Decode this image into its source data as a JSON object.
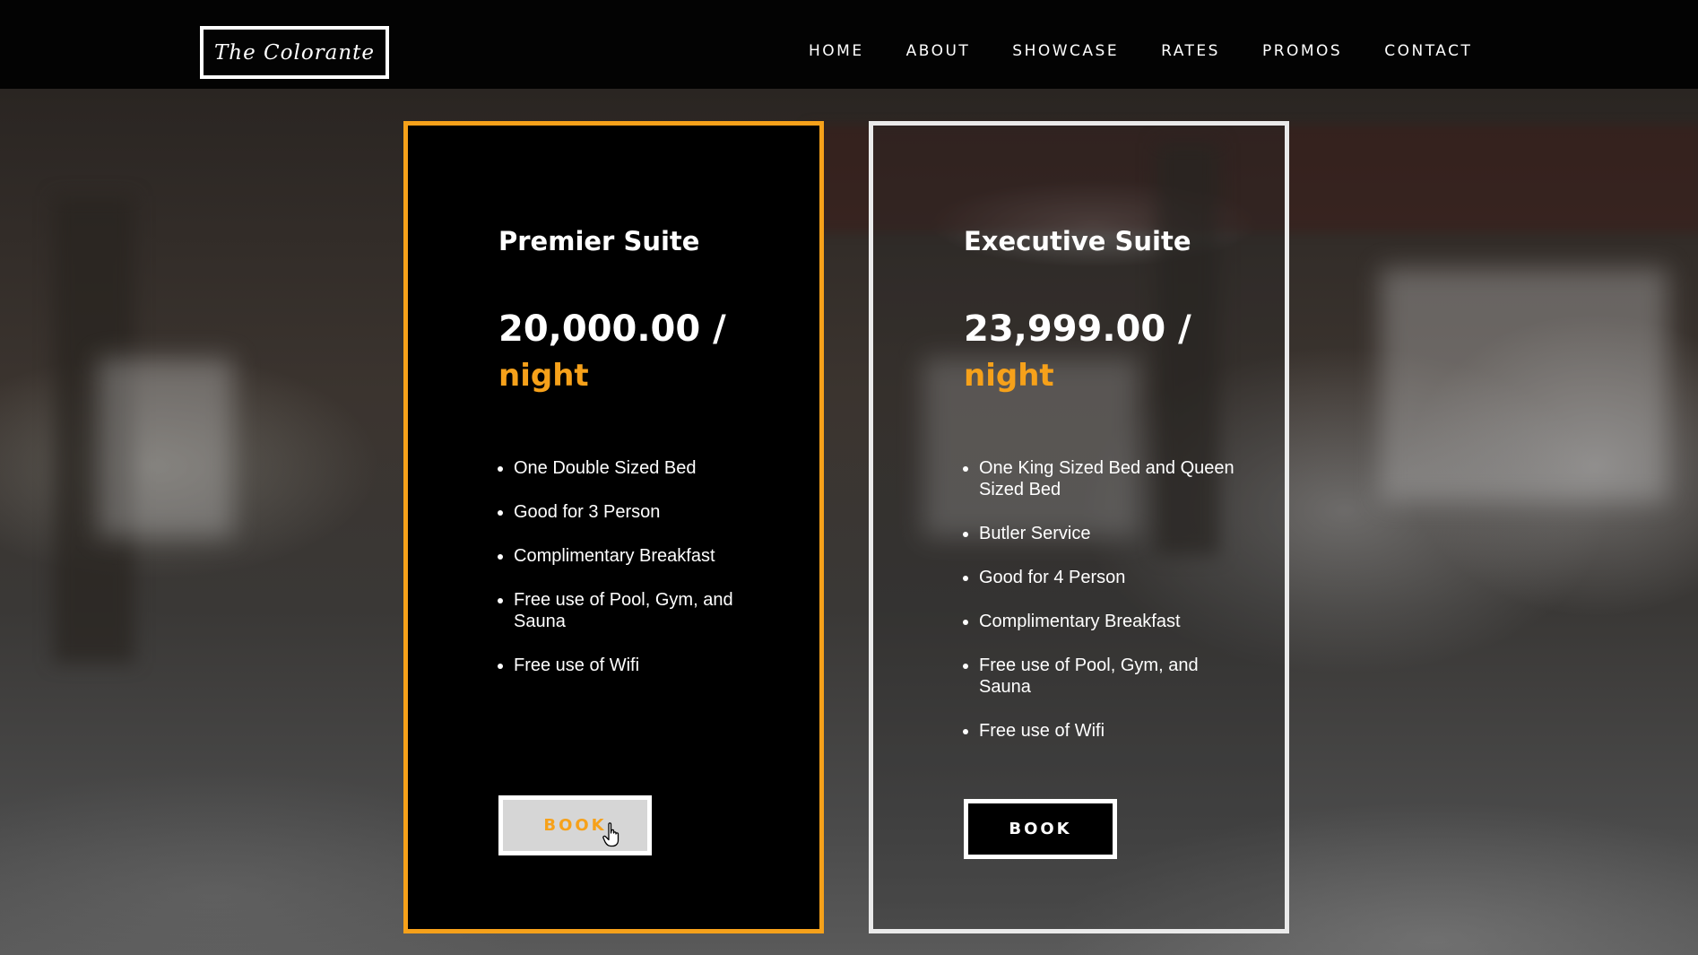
{
  "header": {
    "logo_text": "The Colorante",
    "nav": [
      "HOME",
      "ABOUT",
      "SHOWCASE",
      "RATES",
      "PROMOS",
      "CONTACT"
    ]
  },
  "cards": [
    {
      "title": "Premier Suite",
      "price": "20,000.00 /",
      "unit": "night",
      "features": [
        "One Double Sized Bed",
        "Good for 3 Person",
        "Complimentary Breakfast",
        "Free use of Pool, Gym, and Sauna",
        "Free use of Wifi"
      ],
      "button": "BOOK",
      "state": "hover"
    },
    {
      "title": "Executive Suite",
      "price": "23,999.00 /",
      "unit": "night",
      "features": [
        "One King Sized Bed and Queen Sized Bed",
        "Butler Service",
        "Good for 4 Person",
        "Complimentary Breakfast",
        "Free use of Pool, Gym, and Sauna",
        "Free use of Wifi"
      ],
      "button": "BOOK",
      "state": "default"
    }
  ],
  "colors": {
    "accent": "#f6a11a",
    "header_bg": "#030303",
    "card_border_secondary": "#eaeaea"
  },
  "icons": {
    "cursor": "hand-pointer-icon"
  }
}
